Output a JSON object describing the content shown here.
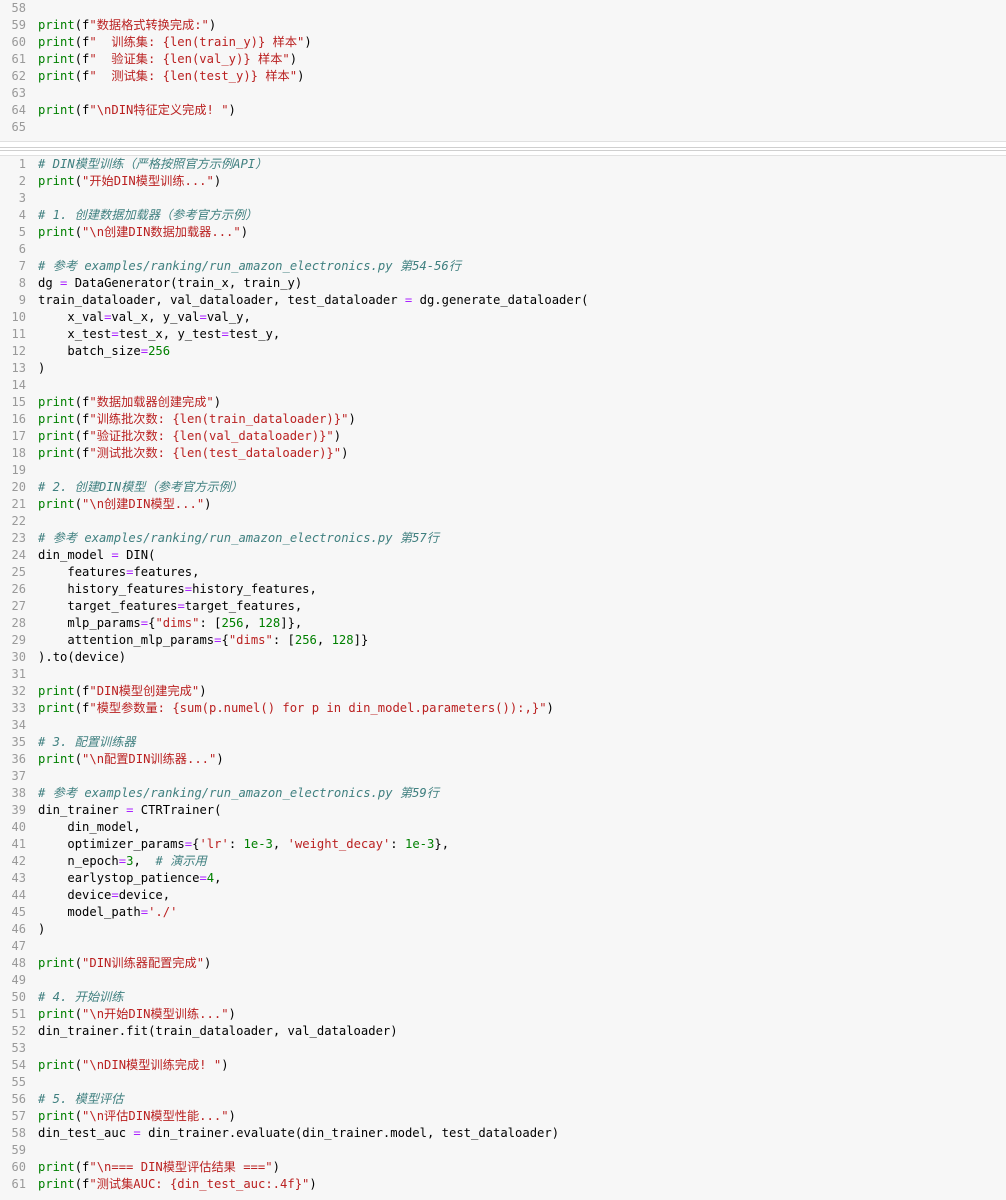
{
  "colors": {
    "background": "#f7f7f7",
    "line_number": "#999999",
    "comment": "#408080",
    "string": "#ba2121",
    "number": "#008000",
    "keyword": "#008000"
  },
  "cells": [
    {
      "id": "cell-top",
      "lines": [
        {
          "n": "58",
          "code": ""
        },
        {
          "n": "59",
          "code": "print(f\"数据格式转换完成:\")"
        },
        {
          "n": "60",
          "code": "print(f\"  训练集: {len(train_y)} 样本\")"
        },
        {
          "n": "61",
          "code": "print(f\"  验证集: {len(val_y)} 样本\")"
        },
        {
          "n": "62",
          "code": "print(f\"  测试集: {len(test_y)} 样本\")"
        },
        {
          "n": "63",
          "code": ""
        },
        {
          "n": "64",
          "code": "print(f\"\\nDIN特征定义完成! \")"
        },
        {
          "n": "65",
          "code": ""
        }
      ]
    },
    {
      "id": "cell-bottom",
      "lines": [
        {
          "n": "1",
          "code": "# DIN模型训练（严格按照官方示例API）"
        },
        {
          "n": "2",
          "code": "print(\"开始DIN模型训练...\")"
        },
        {
          "n": "3",
          "code": ""
        },
        {
          "n": "4",
          "code": "# 1. 创建数据加载器（参考官方示例）"
        },
        {
          "n": "5",
          "code": "print(\"\\n创建DIN数据加载器...\")"
        },
        {
          "n": "6",
          "code": ""
        },
        {
          "n": "7",
          "code": "# 参考 examples/ranking/run_amazon_electronics.py 第54-56行"
        },
        {
          "n": "8",
          "code": "dg = DataGenerator(train_x, train_y)"
        },
        {
          "n": "9",
          "code": "train_dataloader, val_dataloader, test_dataloader = dg.generate_dataloader("
        },
        {
          "n": "10",
          "code": "    x_val=val_x, y_val=val_y,"
        },
        {
          "n": "11",
          "code": "    x_test=test_x, y_test=test_y,"
        },
        {
          "n": "12",
          "code": "    batch_size=256"
        },
        {
          "n": "13",
          "code": ")"
        },
        {
          "n": "14",
          "code": ""
        },
        {
          "n": "15",
          "code": "print(f\"数据加载器创建完成\")"
        },
        {
          "n": "16",
          "code": "print(f\"训练批次数: {len(train_dataloader)}\")"
        },
        {
          "n": "17",
          "code": "print(f\"验证批次数: {len(val_dataloader)}\")"
        },
        {
          "n": "18",
          "code": "print(f\"测试批次数: {len(test_dataloader)}\")"
        },
        {
          "n": "19",
          "code": ""
        },
        {
          "n": "20",
          "code": "# 2. 创建DIN模型（参考官方示例）"
        },
        {
          "n": "21",
          "code": "print(\"\\n创建DIN模型...\")"
        },
        {
          "n": "22",
          "code": ""
        },
        {
          "n": "23",
          "code": "# 参考 examples/ranking/run_amazon_electronics.py 第57行"
        },
        {
          "n": "24",
          "code": "din_model = DIN("
        },
        {
          "n": "25",
          "code": "    features=features,"
        },
        {
          "n": "26",
          "code": "    history_features=history_features,"
        },
        {
          "n": "27",
          "code": "    target_features=target_features,"
        },
        {
          "n": "28",
          "code": "    mlp_params={\"dims\": [256, 128]},"
        },
        {
          "n": "29",
          "code": "    attention_mlp_params={\"dims\": [256, 128]}"
        },
        {
          "n": "30",
          "code": ").to(device)"
        },
        {
          "n": "31",
          "code": ""
        },
        {
          "n": "32",
          "code": "print(f\"DIN模型创建完成\")"
        },
        {
          "n": "33",
          "code": "print(f\"模型参数量: {sum(p.numel() for p in din_model.parameters()):,}\")"
        },
        {
          "n": "34",
          "code": ""
        },
        {
          "n": "35",
          "code": "# 3. 配置训练器"
        },
        {
          "n": "36",
          "code": "print(\"\\n配置DIN训练器...\")"
        },
        {
          "n": "37",
          "code": ""
        },
        {
          "n": "38",
          "code": "# 参考 examples/ranking/run_amazon_electronics.py 第59行"
        },
        {
          "n": "39",
          "code": "din_trainer = CTRTrainer("
        },
        {
          "n": "40",
          "code": "    din_model,"
        },
        {
          "n": "41",
          "code": "    optimizer_params={'lr': 1e-3, 'weight_decay': 1e-3},"
        },
        {
          "n": "42",
          "code": "    n_epoch=3,  # 演示用"
        },
        {
          "n": "43",
          "code": "    earlystop_patience=4,"
        },
        {
          "n": "44",
          "code": "    device=device,"
        },
        {
          "n": "45",
          "code": "    model_path='./'"
        },
        {
          "n": "46",
          "code": ")"
        },
        {
          "n": "47",
          "code": ""
        },
        {
          "n": "48",
          "code": "print(\"DIN训练器配置完成\")"
        },
        {
          "n": "49",
          "code": ""
        },
        {
          "n": "50",
          "code": "# 4. 开始训练"
        },
        {
          "n": "51",
          "code": "print(\"\\n开始DIN模型训练...\")"
        },
        {
          "n": "52",
          "code": "din_trainer.fit(train_dataloader, val_dataloader)"
        },
        {
          "n": "53",
          "code": ""
        },
        {
          "n": "54",
          "code": "print(\"\\nDIN模型训练完成! \")"
        },
        {
          "n": "55",
          "code": ""
        },
        {
          "n": "56",
          "code": "# 5. 模型评估"
        },
        {
          "n": "57",
          "code": "print(\"\\n评估DIN模型性能...\")"
        },
        {
          "n": "58",
          "code": "din_test_auc = din_trainer.evaluate(din_trainer.model, test_dataloader)"
        },
        {
          "n": "59",
          "code": ""
        },
        {
          "n": "60",
          "code": "print(f\"\\n=== DIN模型评估结果 ===\")"
        },
        {
          "n": "61",
          "code": "print(f\"测试集AUC: {din_test_auc:.4f}\")"
        }
      ]
    }
  ]
}
